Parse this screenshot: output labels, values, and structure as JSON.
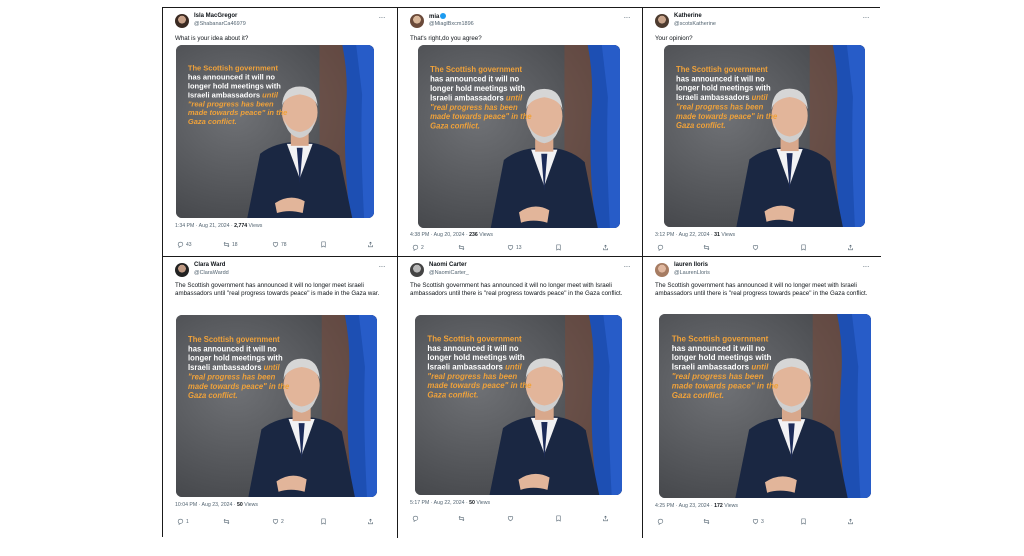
{
  "image_text": {
    "line1": "The Scottish government",
    "line2": "has announced it will no",
    "line3": "longer hold meetings with",
    "line4": "Israeli ambassadors",
    "line4b": "until",
    "line5": "\"real progress has been",
    "line6": "made towards peace\" in the",
    "line7": "Gaza conflict."
  },
  "colors": {
    "accent": "#f0a23a",
    "text_white": "#ffffff",
    "flag_blue": "#1d4fb3",
    "suit_navy": "#1a2742"
  },
  "tweets": [
    {
      "name": "Isla MacGregor",
      "verified": false,
      "handle": "@ShabanarCa46979",
      "text": "What is your idea about it?",
      "time": "1:34 PM · Aug 21, 2024 · ",
      "views": "2,774",
      "views_label": " Views",
      "replies": "43",
      "retweets": "18",
      "likes": "78"
    },
    {
      "name": "mia",
      "verified": true,
      "handle": "@MiaglBxcm1896",
      "text": "That's right,do you agree?",
      "time": "4:38 PM · Aug 20, 2024 · ",
      "views": "236",
      "views_label": " Views",
      "replies": "2",
      "retweets": "",
      "likes": "13"
    },
    {
      "name": "Katherine",
      "verified": false,
      "handle": "@scotsKatherine",
      "text": "Your opinion?",
      "time": "3:12 PM · Aug 22, 2024 · ",
      "views": "31",
      "views_label": " Views",
      "replies": "",
      "retweets": "",
      "likes": ""
    },
    {
      "name": "Clara Ward",
      "verified": false,
      "handle": "@ClaraWardd",
      "text": "The Scottish government has announced it will no longer meet israeli ambassadors until \"real progress towards peace\" is made in the Gaza war.",
      "time": "10:04 PM · Aug 23, 2024 · ",
      "views": "50",
      "views_label": " Views",
      "replies": "1",
      "retweets": "",
      "likes": "2"
    },
    {
      "name": "Naomi Carter",
      "verified": false,
      "handle": "@NaomiCarter_",
      "text": "The Scottish government has announced it will no longer meet with Israeli ambassadors until there is \"real progress towards peace\" in the Gaza conflict.",
      "time": "5:17 PM · Aug 22, 2024 · ",
      "views": "50",
      "views_label": " Views",
      "replies": "",
      "retweets": "",
      "likes": ""
    },
    {
      "name": "lauren lloris",
      "verified": false,
      "handle": "@LaurenLloris",
      "text": "The Scottish government has announced it will no longer meet with Israeli ambassadors until there is \"real progress towards peace\" in the Gaza conflict.",
      "time": "4:25 PM · Aug 23, 2024 · ",
      "views": "172",
      "views_label": " Views",
      "replies": "",
      "retweets": "",
      "likes": "3"
    }
  ]
}
